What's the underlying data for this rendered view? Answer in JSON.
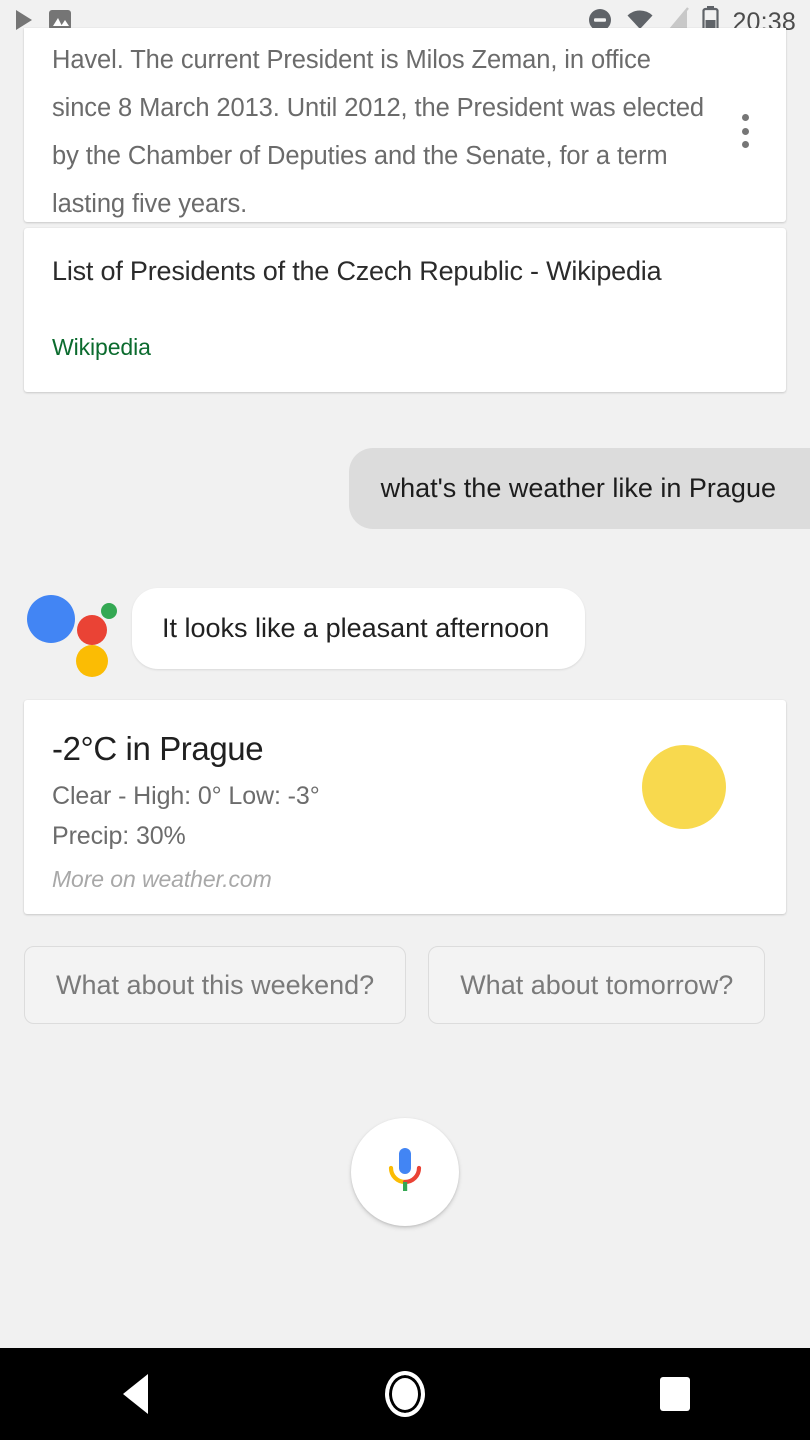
{
  "status_bar": {
    "time": "20:38",
    "left_icons": [
      "play-icon",
      "image-icon"
    ],
    "right_icons": [
      "do-not-disturb-icon",
      "wifi-icon",
      "no-sim-icon",
      "battery-icon"
    ]
  },
  "knowledge_card": {
    "snippet": "Havel. The current President is Milos Zeman, in office since 8 March 2013. Until 2012, the President was elected by the Chamber of Deputies and the Senate, for a term lasting five years.",
    "overflow_menu": "more-options"
  },
  "result_card": {
    "title": "List of Presidents of the Czech Republic - Wikipedia",
    "source": "Wikipedia",
    "source_color": "#0b6b2e"
  },
  "conversation": {
    "user_query": "what's the weather like in Prague",
    "assistant_reply": "It looks like a pleasant afternoon"
  },
  "weather_card": {
    "temperature": "-2°C in Prague",
    "conditions": "Clear - High: 0° Low: -3°",
    "precipitation": "Precip: 30%",
    "link": "More on weather.com",
    "icon": "sun-icon",
    "sun_color": "#f8d94e"
  },
  "suggestion_chips": [
    {
      "label": "What about this weekend?"
    },
    {
      "label": "What about tomorrow?"
    }
  ],
  "mic_button": {
    "icon": "microphone-icon"
  },
  "nav_bar": {
    "back": "back-button",
    "home": "home-button",
    "recents": "recents-button"
  },
  "theme": {
    "background": "#f1f1f1",
    "card": "#ffffff",
    "user_bubble": "#dcdcdc",
    "google_blue": "#4285f4",
    "google_red": "#ea4335",
    "google_yellow": "#fbbc04",
    "google_green": "#34a853"
  }
}
